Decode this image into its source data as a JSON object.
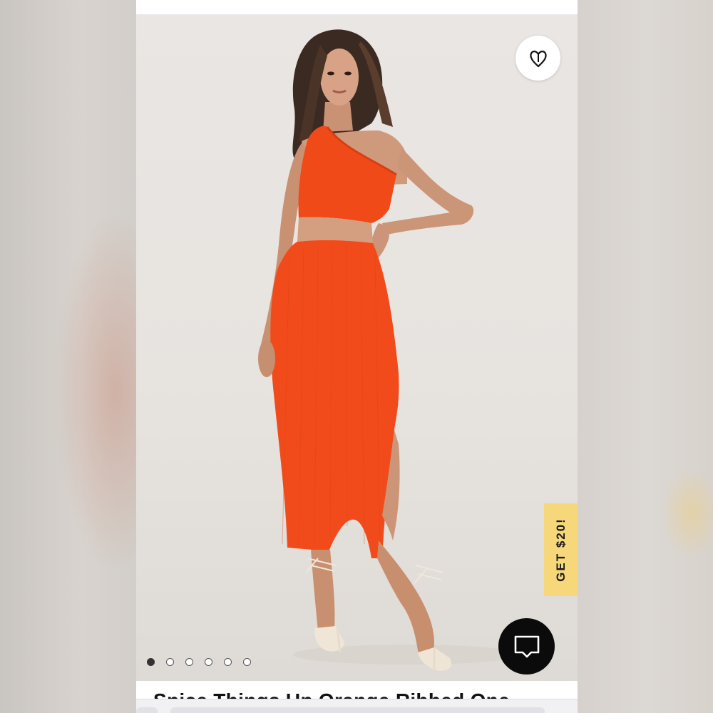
{
  "product": {
    "title": "Spice Things Up Orange Ribbed One",
    "image_alt": "Model wearing an orange ribbed one-shoulder cutout midi dress with nude lace-up heels"
  },
  "wishlist": {
    "icon": "heart-outline-icon"
  },
  "promo": {
    "label": "GET $20!",
    "color": "#f6d77a"
  },
  "chat": {
    "icon": "chat-bubble-icon"
  },
  "carousel": {
    "total": 6,
    "active": 1
  },
  "colors": {
    "dress": "#f24a1a",
    "background": "#e8e4e0",
    "chat_button": "#0b0b0b"
  }
}
